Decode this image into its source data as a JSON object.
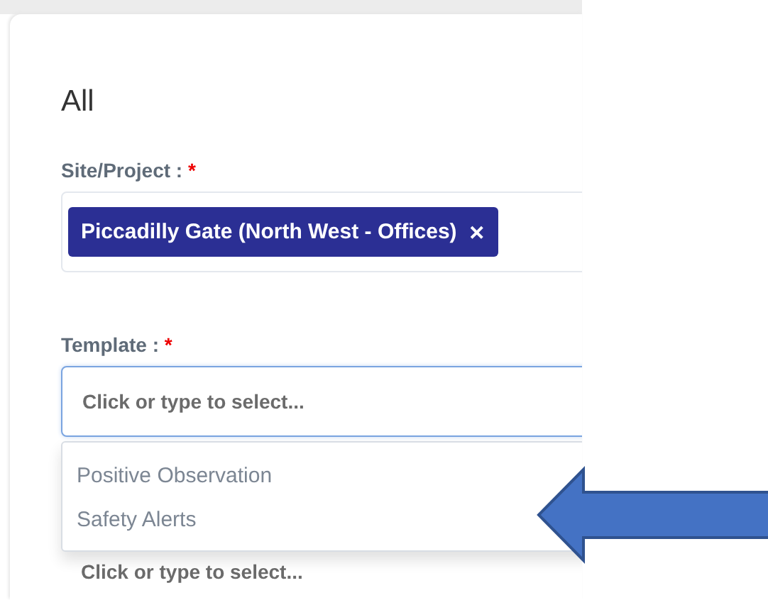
{
  "heading": "All",
  "site_field": {
    "label": "Site/Project :",
    "required_mark": "*",
    "chips": [
      {
        "label": "Piccadilly Gate (North West - Offices)",
        "remove": "✕"
      }
    ]
  },
  "template_field": {
    "label": "Template :",
    "required_mark": "*",
    "placeholder": "Click or type to select...",
    "expanded": true,
    "options": [
      {
        "label": "Positive Observation"
      },
      {
        "label": "Safety Alerts"
      }
    ]
  },
  "next_field": {
    "placeholder": "Click or type to select..."
  }
}
